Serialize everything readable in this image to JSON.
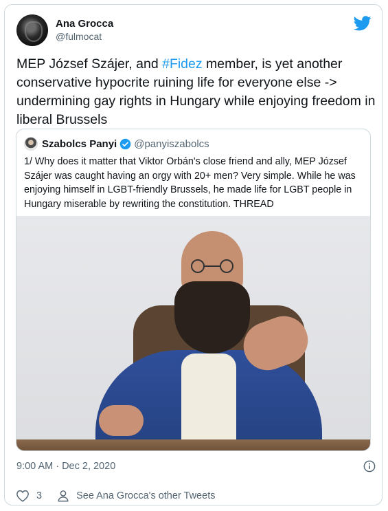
{
  "author": {
    "display_name": "Ana Grocca",
    "handle": "@fulmocat"
  },
  "tweet": {
    "text_before": "MEP József Szájer, and ",
    "hashtag": "#Fidez",
    "text_after": " member, is yet another conservative hypocrite ruining life for everyone else -> undermining gay rights in Hungary while enjoying freedom in liberal Brussels"
  },
  "quoted": {
    "display_name": "Szabolcs Panyi",
    "handle": "@panyiszabolcs",
    "text": "1/ Why does it matter that Viktor Orbán's close friend and ally, MEP József Szájer was caught having an orgy with 20+ men? Very simple. While he was enjoying himself in LGBT-friendly Brussels, he made life for LGBT people in Hungary miserable by rewriting the constitution. THREAD"
  },
  "meta": {
    "timestamp": "9:00 AM · Dec 2, 2020",
    "likes": "3",
    "other_tweets_label": "See Ana Grocca's other Tweets"
  },
  "icons": {
    "brand": "twitter-bird-icon",
    "verified": "verified-badge-icon",
    "info": "info-icon",
    "like": "heart-icon",
    "profile": "person-icon"
  },
  "colors": {
    "brand_blue": "#1d9bf0",
    "secondary_text": "#536471",
    "primary_text": "#0f1419",
    "border": "#cfd9de"
  }
}
